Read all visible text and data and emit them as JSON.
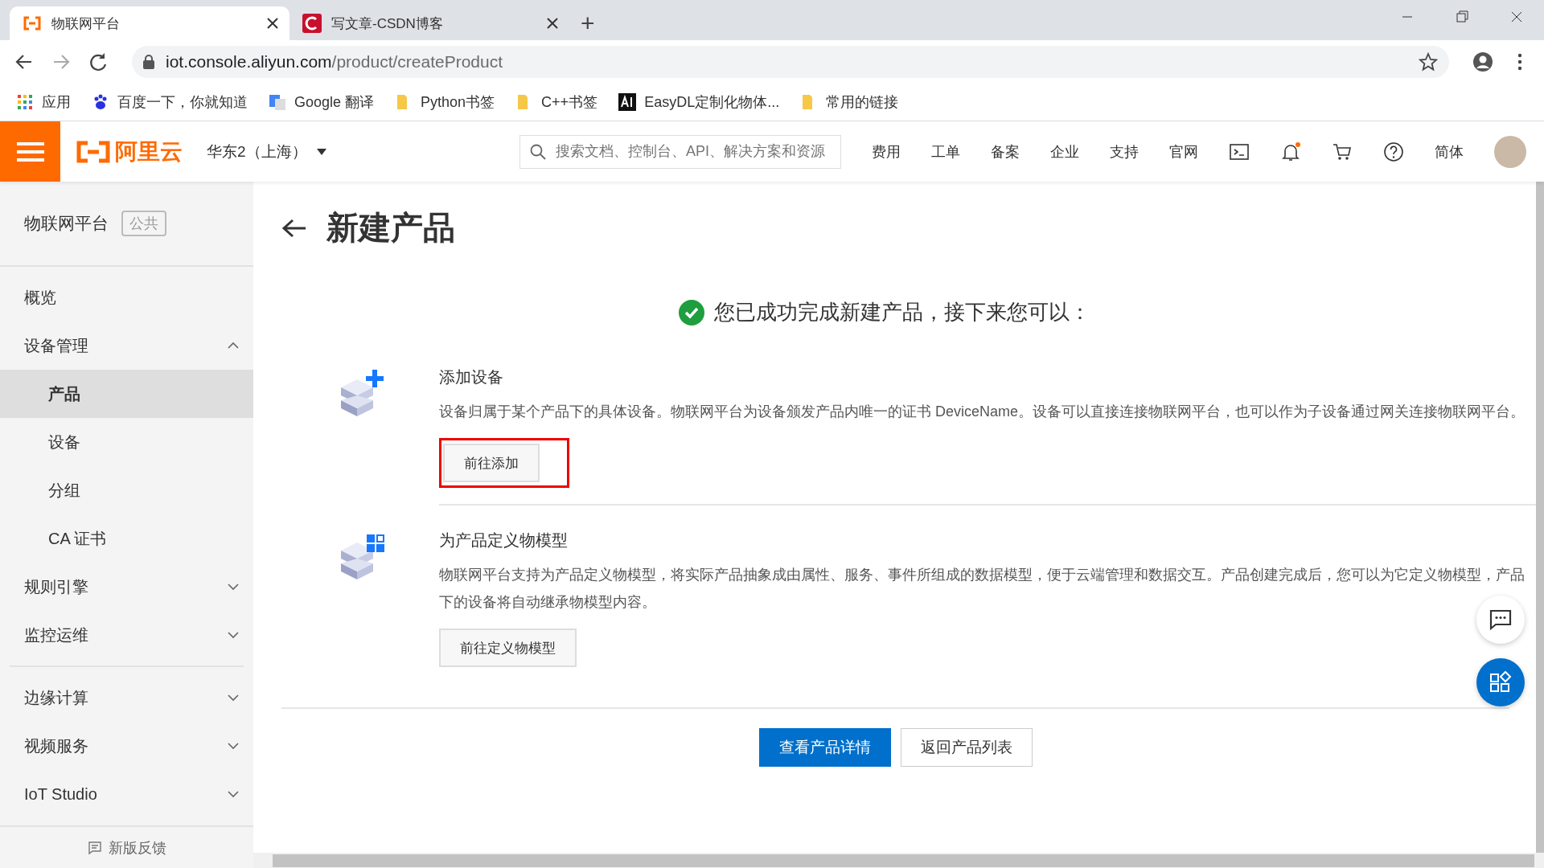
{
  "browser": {
    "tabs": [
      {
        "title": "物联网平台",
        "selected": true,
        "kind": "aliyun"
      },
      {
        "title": "写文章-CSDN博客",
        "selected": false,
        "kind": "csdn"
      }
    ],
    "new_tab": "+",
    "url_host": "iot.console.aliyun.com",
    "url_path": "/product/createProduct",
    "bookmarks": [
      {
        "label": "应用",
        "kind": "apps"
      },
      {
        "label": "百度一下，你就知道",
        "kind": "paw"
      },
      {
        "label": "Google 翻译",
        "kind": "translate"
      },
      {
        "label": "Python书签",
        "kind": "folder"
      },
      {
        "label": "C++书签",
        "kind": "folder"
      },
      {
        "label": "EasyDL定制化物体...",
        "kind": "ai"
      },
      {
        "label": "常用的链接",
        "kind": "folder"
      }
    ]
  },
  "header": {
    "logo": "阿里云",
    "region": "华东2（上海）",
    "search": {
      "placeholder": "搜索文档、控制台、API、解决方案和资源"
    },
    "nav": [
      "费用",
      "工单",
      "备案",
      "企业",
      "支持",
      "官网"
    ],
    "language": "简体"
  },
  "sidebar": {
    "title": "物联网平台",
    "badge": "公共",
    "sections": [
      {
        "items": [
          {
            "label": "概览",
            "kind": "link"
          },
          {
            "label": "设备管理",
            "kind": "group",
            "expanded": true,
            "children": [
              {
                "label": "产品",
                "selected": true
              },
              {
                "label": "设备",
                "selected": false
              },
              {
                "label": "分组",
                "selected": false
              },
              {
                "label": "CA 证书",
                "selected": false
              }
            ]
          },
          {
            "label": "规则引擎",
            "kind": "group",
            "expanded": false
          },
          {
            "label": "监控运维",
            "kind": "group",
            "expanded": false
          }
        ]
      },
      {
        "items": [
          {
            "label": "边缘计算",
            "kind": "group",
            "expanded": false
          },
          {
            "label": "视频服务",
            "kind": "group",
            "expanded": false
          },
          {
            "label": "IoT Studio",
            "kind": "group",
            "expanded": false
          }
        ]
      }
    ],
    "feedback": "新版反馈"
  },
  "page": {
    "title": "新建产品",
    "success": "您已成功完成新建产品，接下来您可以：",
    "steps": [
      {
        "kind": "add",
        "title": "添加设备",
        "description": "设备归属于某个产品下的具体设备。物联网平台为设备颁发产品内唯一的证书 DeviceName。设备可以直接连接物联网平台，也可以作为子设备通过网关连接物联网平台。",
        "button": "前往添加",
        "highlighted": true
      },
      {
        "kind": "model",
        "title": "为产品定义物模型",
        "description": "物联网平台支持为产品定义物模型，将实际产品抽象成由属性、服务、事件所组成的数据模型，便于云端管理和数据交互。产品创建完成后，您可以为它定义物模型，产品下的设备将自动继承物模型内容。",
        "button": "前往定义物模型",
        "highlighted": false
      }
    ],
    "actions": [
      {
        "label": "查看产品详情",
        "kind": "primary"
      },
      {
        "label": "返回产品列表",
        "kind": "default"
      }
    ]
  }
}
